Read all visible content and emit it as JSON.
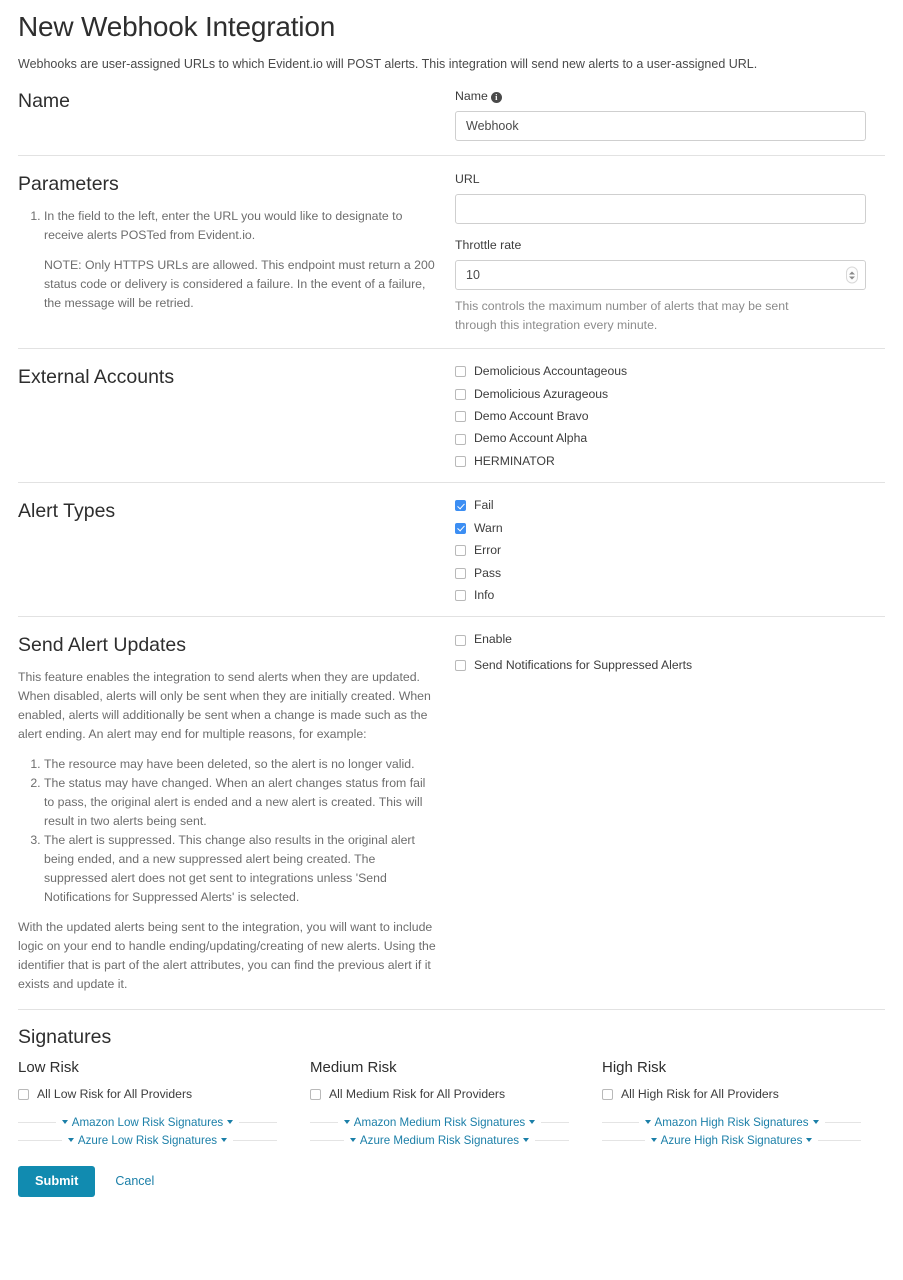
{
  "page": {
    "title": "New Webhook Integration",
    "intro": "Webhooks are user-assigned URLs to which Evident.io will POST alerts. This integration will send new alerts to a user-assigned URL."
  },
  "name_section": {
    "heading": "Name",
    "field_label": "Name",
    "info_icon_glyph": "i",
    "value": "Webhook",
    "placeholder": ""
  },
  "parameters_section": {
    "heading": "Parameters",
    "instructions": [
      "In the field to the left, enter the URL you would like to designate to receive alerts POSTed from Evident.io."
    ],
    "note": "NOTE: Only HTTPS URLs are allowed. This endpoint must return a 200 status code or delivery is considered a failure. In the event of a failure, the message will be retried.",
    "url_label": "URL",
    "url_value": "",
    "url_placeholder": "",
    "throttle_label": "Throttle rate",
    "throttle_value": "10",
    "throttle_help": "This controls the maximum number of alerts that may be sent through this integration every minute."
  },
  "external_accounts": {
    "heading": "External Accounts",
    "items": [
      {
        "label": "Demolicious Accountageous",
        "checked": false
      },
      {
        "label": "Demolicious Azurageous",
        "checked": false
      },
      {
        "label": "Demo Account Bravo",
        "checked": false
      },
      {
        "label": "Demo Account Alpha",
        "checked": false
      },
      {
        "label": "HERMINATOR",
        "checked": false
      }
    ]
  },
  "alert_types": {
    "heading": "Alert Types",
    "items": [
      {
        "label": "Fail",
        "checked": true
      },
      {
        "label": "Warn",
        "checked": true
      },
      {
        "label": "Error",
        "checked": false
      },
      {
        "label": "Pass",
        "checked": false
      },
      {
        "label": "Info",
        "checked": false
      }
    ]
  },
  "send_alert_updates": {
    "heading": "Send Alert Updates",
    "paragraph1": "This feature enables the integration to send alerts when they are updated. When disabled, alerts will only be sent when they are initially created. When enabled, alerts will additionally be sent when a change is made such as the alert ending. An alert may end for multiple reasons, for example:",
    "reasons": [
      "The resource may have been deleted, so the alert is no longer valid.",
      "The status may have changed. When an alert changes status from fail to pass, the original alert is ended and a new alert is created. This will result in two alerts being sent.",
      "The alert is suppressed. This change also results in the original alert being ended, and a new suppressed alert being created. The suppressed alert does not get sent to integrations unless 'Send Notifications for Suppressed Alerts' is selected."
    ],
    "paragraph2": "With the updated alerts being sent to the integration, you will want to include logic on your end to handle ending/updating/creating of new alerts. Using the identifier that is part of the alert attributes, you can find the previous alert if it exists and update it.",
    "items": [
      {
        "label": "Enable",
        "checked": false
      },
      {
        "label": "Send Notifications for Suppressed Alerts",
        "checked": false
      }
    ]
  },
  "signatures": {
    "heading": "Signatures",
    "columns": [
      {
        "title": "Low Risk",
        "all_label": "All Low Risk for All Providers",
        "all_checked": false,
        "links": [
          "Amazon Low Risk Signatures",
          "Azure Low Risk Signatures"
        ]
      },
      {
        "title": "Medium Risk",
        "all_label": "All Medium Risk for All Providers",
        "all_checked": false,
        "links": [
          "Amazon Medium Risk Signatures",
          "Azure Medium Risk Signatures"
        ]
      },
      {
        "title": "High Risk",
        "all_label": "All High Risk for All Providers",
        "all_checked": false,
        "links": [
          "Amazon High Risk Signatures",
          "Azure High Risk Signatures"
        ]
      }
    ]
  },
  "footer": {
    "submit_label": "Submit",
    "cancel_label": "Cancel"
  },
  "colors": {
    "accent_button": "#118bb0",
    "link": "#1b7fa8",
    "checkbox_checked": "#3c8ef3",
    "divider": "#e2e2e2",
    "text": "#3d3d3d",
    "muted_text": "#6d6d6d"
  }
}
